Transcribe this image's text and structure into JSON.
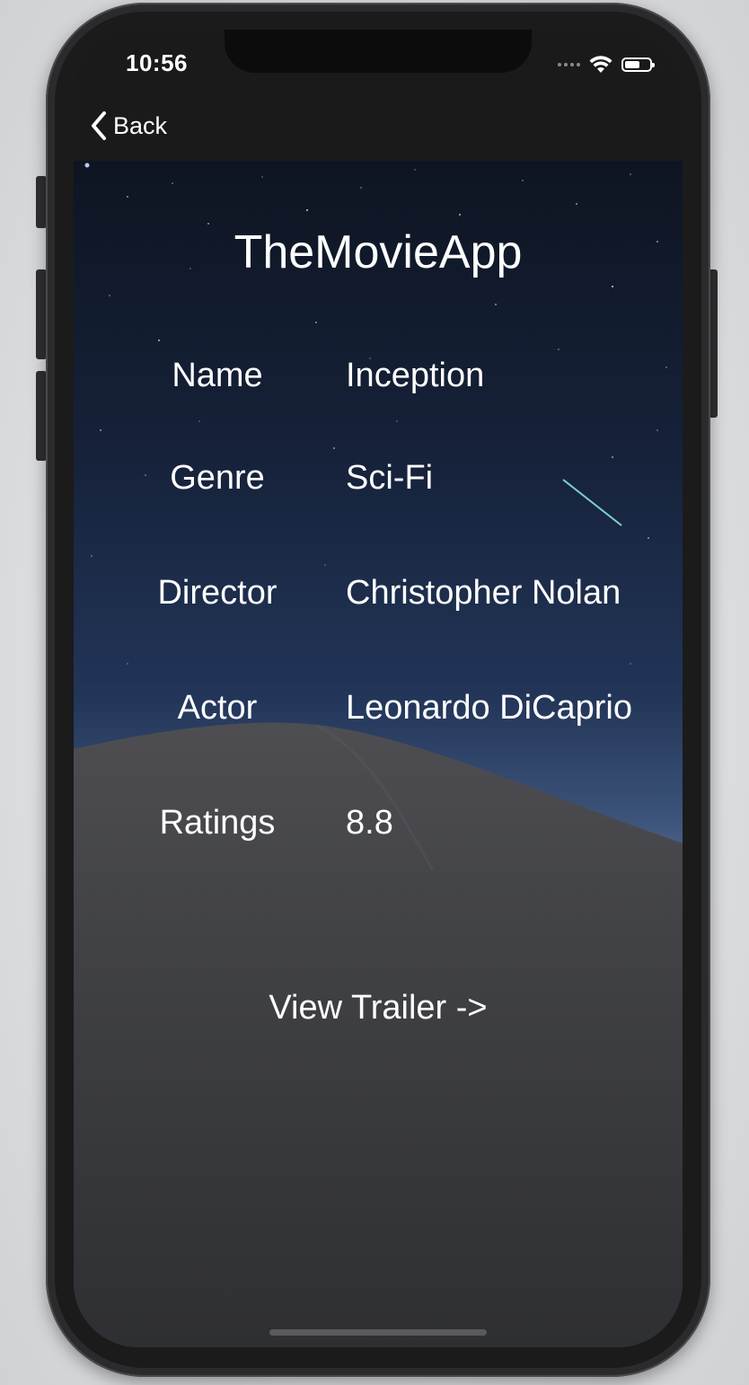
{
  "status_bar": {
    "time": "10:56",
    "icons": [
      "cellular-signal-icon",
      "wifi-icon",
      "battery-icon"
    ]
  },
  "nav": {
    "back_label": "Back",
    "back_icon": "chevron-left-icon"
  },
  "main": {
    "title": "TheMovieApp",
    "rows": [
      {
        "label": "Name",
        "value": "Inception"
      },
      {
        "label": "Genre",
        "value": "Sci-Fi"
      },
      {
        "label": "Director",
        "value": "Christopher Nolan"
      },
      {
        "label": "Actor",
        "value": "Leonardo DiCaprio"
      },
      {
        "label": "Ratings",
        "value": "8.8"
      }
    ],
    "trailer_button": "View Trailer ->"
  },
  "colors": {
    "text": "#ffffff",
    "bar_background": "#1a1a1b",
    "sky_top": "#0e1522",
    "sky_horizon": "#5a6f96",
    "sand": "#3d3f45"
  }
}
